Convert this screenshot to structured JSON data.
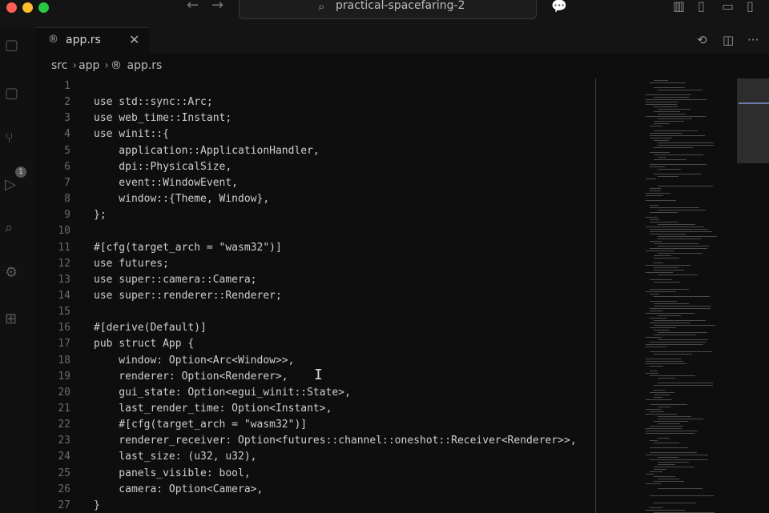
{
  "window": {
    "search_text": "practical-spacefaring-2"
  },
  "tab": {
    "label": "app.rs",
    "close": "✕"
  },
  "breadcrumb": [
    "src",
    "app",
    "app.rs"
  ],
  "editor": {
    "lines": [
      {
        "n": "1",
        "code": ""
      },
      {
        "n": "2",
        "code": "use std::sync::Arc;"
      },
      {
        "n": "3",
        "code": "use web_time::Instant;"
      },
      {
        "n": "4",
        "code": "use winit::{"
      },
      {
        "n": "5",
        "code": "    application::ApplicationHandler,"
      },
      {
        "n": "6",
        "code": "    dpi::PhysicalSize,"
      },
      {
        "n": "7",
        "code": "    event::WindowEvent,"
      },
      {
        "n": "8",
        "code": "    window::{Theme, Window},"
      },
      {
        "n": "9",
        "code": "};"
      },
      {
        "n": "10",
        "code": ""
      },
      {
        "n": "11",
        "code": "#[cfg(target_arch = \"wasm32\")]"
      },
      {
        "n": "12",
        "code": "use futures;"
      },
      {
        "n": "13",
        "code": "use super::camera::Camera;"
      },
      {
        "n": "14",
        "code": "use super::renderer::Renderer;"
      },
      {
        "n": "15",
        "code": ""
      },
      {
        "n": "16",
        "code": "#[derive(Default)]"
      },
      {
        "n": "17",
        "code": "pub struct App {"
      },
      {
        "n": "18",
        "code": "    window: Option<Arc<Window>>,"
      },
      {
        "n": "19",
        "code": "    renderer: Option<Renderer>,"
      },
      {
        "n": "20",
        "code": "    gui_state: Option<egui_winit::State>,"
      },
      {
        "n": "21",
        "code": "    last_render_time: Option<Instant>,"
      },
      {
        "n": "22",
        "code": "    #[cfg(target_arch = \"wasm32\")]"
      },
      {
        "n": "23",
        "code": "    renderer_receiver: Option<futures::channel::oneshot::Receiver<Renderer>>,"
      },
      {
        "n": "24",
        "code": "    last_size: (u32, u32),"
      },
      {
        "n": "25",
        "code": "    panels_visible: bool,"
      },
      {
        "n": "26",
        "code": "    camera: Option<Camera>,"
      },
      {
        "n": "27",
        "code": "}"
      }
    ]
  },
  "icons": {
    "search": "search-icon",
    "back": "arrow-left-icon",
    "forward": "arrow-right-icon",
    "chat": "chat-icon",
    "layout": "layout-icon",
    "rust_file": "rust-file-icon",
    "history": "history-icon",
    "split": "split-editor-icon",
    "more": "more-icon"
  },
  "activity_badge": "1"
}
